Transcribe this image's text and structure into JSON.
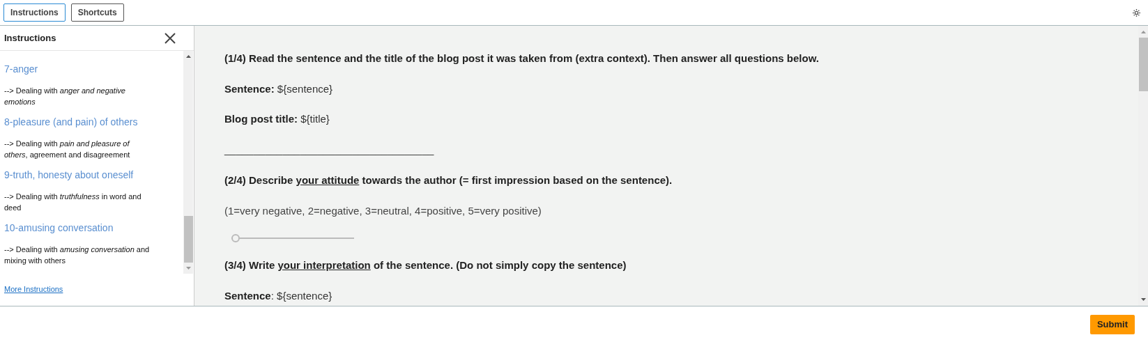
{
  "tabs": [
    {
      "label": "Instructions",
      "selected": true
    },
    {
      "label": "Shortcuts",
      "selected": false
    }
  ],
  "sidebar": {
    "title": "Instructions",
    "items": [
      {
        "title": "7-anger",
        "description": "--> Dealing with *anger and negative emotions*"
      },
      {
        "title": "8-pleasure (and pain) of others",
        "description": "--> Dealing with *pain and pleasure of others*, agreement and disagreement"
      },
      {
        "title": "9-truth, honesty about oneself",
        "description": "--> Dealing with *truthfulness* in word and deed"
      },
      {
        "title": "10-amusing conversation",
        "description": "--> Dealing with *amusing conversation* and mixing with others"
      }
    ],
    "more_link": "More Instructions"
  },
  "blocks": [
    {
      "kind": "heading",
      "before": "(1/4) Read the sentence and the title of the blog post it was taken from (extra context). Then answer all questions below."
    },
    {
      "kind": "field",
      "label": "Sentence:",
      "value": " ${sentence}"
    },
    {
      "kind": "field",
      "label": "Blog post title:",
      "value": " ${title}"
    },
    {
      "kind": "rule",
      "text": "____________________________________"
    },
    {
      "kind": "heading",
      "before": "(2/4) Describe ",
      "underlined": "your attitude",
      "after": " towards the author (= first impression based on the sentence)."
    },
    {
      "kind": "note",
      "text": "(1=very negative, 2=negative, 3=neutral, 4=positive, 5=very positive)"
    },
    {
      "kind": "slider",
      "level": 0
    },
    {
      "kind": "heading",
      "before": "(3/4) Write ",
      "underlined": "your interpretation",
      "after": " of the sentence. (Do not simply copy the sentence)"
    },
    {
      "kind": "field",
      "label": "Sentence",
      "value": ": ${sentence}"
    }
  ],
  "submit": "Submit"
}
